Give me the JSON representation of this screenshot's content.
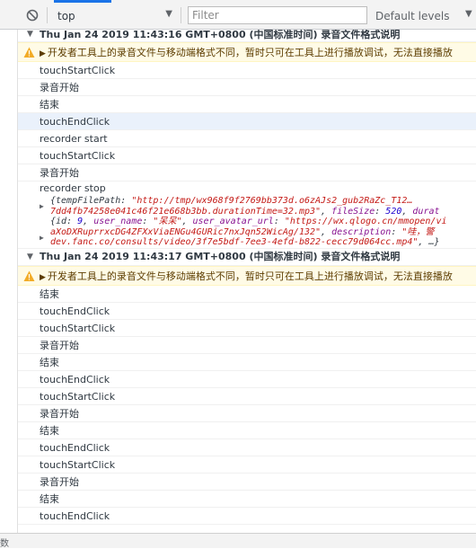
{
  "toolbar": {
    "context": "top",
    "filter_placeholder": "Filter",
    "levels": "Default levels"
  },
  "groups": [
    {
      "header": "Thu Jan 24 2019 11:43:16 GMT+0800 (中国标准时间) 录音文件格式说明",
      "warning": "开发者工具上的录音文件与移动端格式不同，暂时只可在工具上进行播放调试，无法直接播放"
    },
    {
      "header": "Thu Jan 24 2019 11:43:17 GMT+0800 (中国标准时间) 录音文件格式说明",
      "warning": "开发者工具上的录音文件与移动端格式不同，暂时只可在工具上进行播放调试，无法直接播放"
    }
  ],
  "logs_a": [
    "touchStartClick",
    "录音开始",
    "结束",
    "touchEndClick",
    "recorder start",
    "touchStartClick",
    "录音开始",
    "recorder stop"
  ],
  "obj1": {
    "line1_key": "{tempFilePath",
    "line1_val": "\"http://tmp/wx968f9f2769bb373d.o6zAJs2_gub2RaZc_T12…",
    "line2_val": "7dd4fb74258e041c46f21e668b3bb.durationTime=32.mp3\"",
    "line2_k2": "fileSize",
    "line2_v2": "520",
    "line2_k3": "durat"
  },
  "obj2": {
    "line1_k1": "{id",
    "line1_v1": "9",
    "line1_k2": "user_name",
    "line1_v2": "\"呆呆\"",
    "line1_k3": "user_avatar_url",
    "line1_v3": "\"https://wx.qlogo.cn/mmopen/vi",
    "line2_val": "aXoDXRuprrxcDG4ZFXxViaENGu4GURic7nxJqn52WicAg/132\"",
    "line2_k2": "description",
    "line2_v2": "\"哇，警",
    "line3_val": "dev.fanc.co/consults/video/3f7e5bdf-7ee3-4efd-b822-cecc79d064cc.mp4\"",
    "line3_tail": ", …}"
  },
  "logs_b": [
    "结束",
    "touchEndClick",
    "touchStartClick",
    "录音开始",
    "结束",
    "touchEndClick",
    "touchStartClick",
    "录音开始",
    "结束",
    "touchEndClick",
    "touchStartClick",
    "录音开始",
    "结束",
    "touchEndClick"
  ],
  "statusbar": {
    "text": "数"
  },
  "colors": {
    "accent": "#1a73e8",
    "warning_bg": "#fffbe6",
    "string": "#c41a16",
    "key": "#881391",
    "number": "#1c00cf"
  }
}
